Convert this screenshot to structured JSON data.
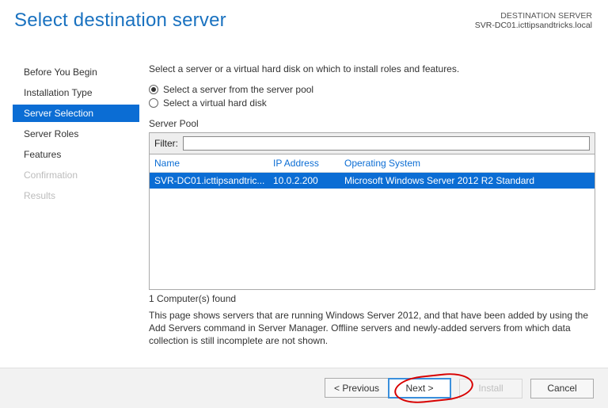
{
  "header": {
    "title": "Select destination server",
    "dest_label": "DESTINATION SERVER",
    "dest_value": "SVR-DC01.icttipsandtricks.local"
  },
  "sidebar": {
    "steps": [
      {
        "label": "Before You Begin",
        "state": "enabled"
      },
      {
        "label": "Installation Type",
        "state": "enabled"
      },
      {
        "label": "Server Selection",
        "state": "active"
      },
      {
        "label": "Server Roles",
        "state": "enabled"
      },
      {
        "label": "Features",
        "state": "enabled"
      },
      {
        "label": "Confirmation",
        "state": "disabled"
      },
      {
        "label": "Results",
        "state": "disabled"
      }
    ]
  },
  "main": {
    "intro": "Select a server or a virtual hard disk on which to install roles and features.",
    "radio1": "Select a server from the server pool",
    "radio2": "Select a virtual hard disk",
    "pool_label": "Server Pool",
    "filter_label": "Filter:",
    "filter_value": "",
    "columns": {
      "name": "Name",
      "ip": "IP Address",
      "os": "Operating System"
    },
    "rows": [
      {
        "name": "SVR-DC01.icttipsandtric...",
        "ip": "10.0.2.200",
        "os": "Microsoft Windows Server 2012 R2 Standard"
      }
    ],
    "found": "1 Computer(s) found",
    "note": "This page shows servers that are running Windows Server 2012, and that have been added by using the Add Servers command in Server Manager. Offline servers and newly-added servers from which data collection is still incomplete are not shown."
  },
  "footer": {
    "previous": "< Previous",
    "next": "Next >",
    "install": "Install",
    "cancel": "Cancel"
  }
}
